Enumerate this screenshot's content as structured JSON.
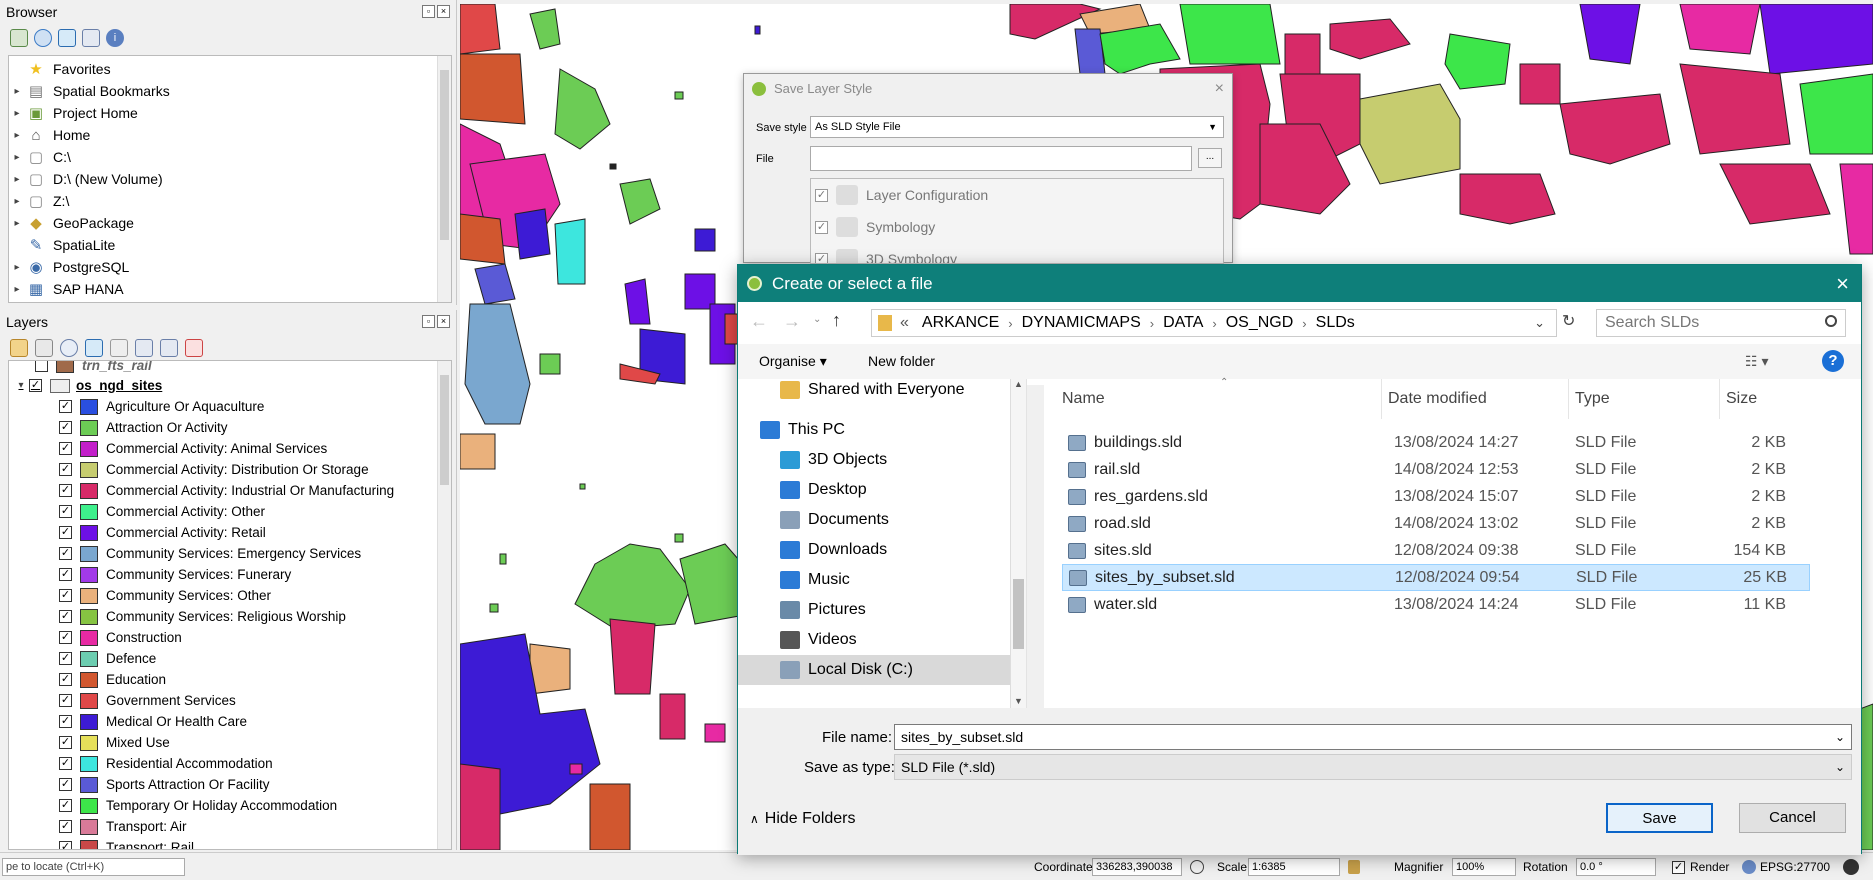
{
  "browser": {
    "title": "Browser",
    "items": [
      "Favorites",
      "Spatial Bookmarks",
      "Project Home",
      "Home",
      "C:\\",
      "D:\\ (New Volume)",
      "Z:\\",
      "GeoPackage",
      "SpatiaLite",
      "PostgreSQL",
      "SAP HANA"
    ]
  },
  "layers": {
    "title": "Layers",
    "top_item": "trn_fts_rail",
    "group": "os_ngd_sites",
    "items": [
      {
        "label": "Agriculture Or Aquaculture",
        "color": "#2a4fe0"
      },
      {
        "label": "Attraction Or Activity",
        "color": "#6ccc55"
      },
      {
        "label": "Commercial Activity: Animal Services",
        "color": "#c21fc9"
      },
      {
        "label": "Commercial Activity: Distribution Or Storage",
        "color": "#c6cc6f"
      },
      {
        "label": "Commercial Activity: Industrial Or Manufacturing",
        "color": "#d72a68"
      },
      {
        "label": "Commercial Activity: Other",
        "color": "#3ef08c"
      },
      {
        "label": "Commercial Activity: Retail",
        "color": "#6d10e6"
      },
      {
        "label": "Community Services: Emergency Services",
        "color": "#7aa7cf"
      },
      {
        "label": "Community Services: Funerary",
        "color": "#a23ae8"
      },
      {
        "label": "Community Services: Other",
        "color": "#eab17c"
      },
      {
        "label": "Community Services: Religious Worship",
        "color": "#86c442"
      },
      {
        "label": "Construction",
        "color": "#e72aa3"
      },
      {
        "label": "Defence",
        "color": "#6ccdb0"
      },
      {
        "label": "Education",
        "color": "#d1572f"
      },
      {
        "label": "Government Services",
        "color": "#e04848"
      },
      {
        "label": "Medical Or Health Care",
        "color": "#3d1bd5"
      },
      {
        "label": "Mixed Use",
        "color": "#e6e05a"
      },
      {
        "label": "Residential Accommodation",
        "color": "#3de6de"
      },
      {
        "label": "Sports Attraction Or Facility",
        "color": "#5a5ad6"
      },
      {
        "label": "Temporary Or Holiday Accommodation",
        "color": "#3de64a"
      },
      {
        "label": "Transport: Air",
        "color": "#d97a98"
      },
      {
        "label": "Transport: Rail",
        "color": "#c94848"
      }
    ]
  },
  "locator": {
    "placeholder": "pe to locate (Ctrl+K)"
  },
  "status": {
    "coordinate_label": "Coordinate",
    "coordinate": "336283,390038",
    "scale_label": "Scale",
    "scale": "1:6385",
    "magnifier_label": "Magnifier",
    "magnifier": "100%",
    "rotation_label": "Rotation",
    "rotation": "0.0 °",
    "render_label": "Render",
    "crs": "EPSG:27700"
  },
  "save_layer_style": {
    "title": "Save Layer Style",
    "save_style_label": "Save style",
    "save_style_value": "As SLD Style File",
    "file_label": "File",
    "browse": "...",
    "categories": [
      "Layer Configuration",
      "Symbology",
      "3D Symbology"
    ]
  },
  "file_dialog": {
    "title": "Create or select a file",
    "path": [
      "ARKANCE",
      "DYNAMICMAPS",
      "DATA",
      "OS_NGD",
      "SLDs"
    ],
    "path_prefix": "«",
    "search_placeholder": "Search SLDs",
    "organise": "Organise ▾",
    "new_folder": "New folder",
    "nav": [
      "Shared with Everyone",
      "This PC",
      "3D Objects",
      "Desktop",
      "Documents",
      "Downloads",
      "Music",
      "Pictures",
      "Videos",
      "Local Disk (C:)"
    ],
    "columns": [
      "Name",
      "Date modified",
      "Type",
      "Size"
    ],
    "files": [
      {
        "name": "buildings.sld",
        "date": "13/08/2024 14:27",
        "type": "SLD File",
        "size": "2 KB"
      },
      {
        "name": "rail.sld",
        "date": "14/08/2024 12:53",
        "type": "SLD File",
        "size": "2 KB"
      },
      {
        "name": "res_gardens.sld",
        "date": "13/08/2024 15:07",
        "type": "SLD File",
        "size": "2 KB"
      },
      {
        "name": "road.sld",
        "date": "14/08/2024 13:02",
        "type": "SLD File",
        "size": "2 KB"
      },
      {
        "name": "sites.sld",
        "date": "12/08/2024 09:38",
        "type": "SLD File",
        "size": "154 KB"
      },
      {
        "name": "sites_by_subset.sld",
        "date": "12/08/2024 09:54",
        "type": "SLD File",
        "size": "25 KB"
      },
      {
        "name": "water.sld",
        "date": "13/08/2024 14:24",
        "type": "SLD File",
        "size": "11 KB"
      }
    ],
    "file_name_label": "File name:",
    "file_name": "sites_by_subset.sld",
    "save_type_label": "Save as type:",
    "save_type": "SLD File (*.sld)",
    "hide_folders": "Hide Folders",
    "save": "Save",
    "cancel": "Cancel"
  }
}
